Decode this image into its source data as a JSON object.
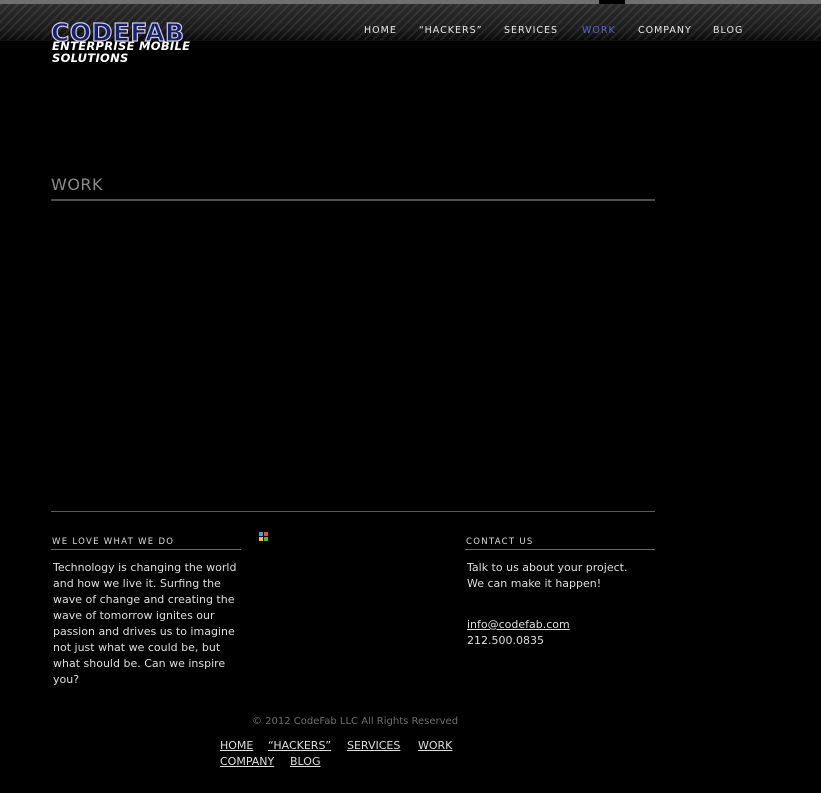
{
  "logo": {
    "brand": "CODEFAB",
    "tagline_line1": "ENTERPRISE MOBILE",
    "tagline_line2": "SOLUTIONS"
  },
  "nav": {
    "items": [
      {
        "label": "HOME",
        "active": false
      },
      {
        "label": "“HACKERS”",
        "active": false
      },
      {
        "label": "SERVICES",
        "active": false
      },
      {
        "label": "WORK",
        "active": true
      },
      {
        "label": "COMPANY",
        "active": false
      },
      {
        "label": "BLOG",
        "active": false
      }
    ]
  },
  "page": {
    "title": "WORK"
  },
  "footer": {
    "about": {
      "heading": "WE LOVE WHAT WE DO",
      "text": "Technology is changing the world and how we live it. Surfing the wave of change and creating the wave of tomorrow ignites our passion and drives us to imagine not just what we could be, but what should be. Can we inspire you?"
    },
    "contact": {
      "heading": "CONTACT US",
      "text": "Talk to us about your project. We can make it happen!",
      "email": "info@codefab.com",
      "phone": "212.500.0835"
    },
    "copyright": "© 2012 CodeFab LLC All Rights Reserved",
    "links": [
      "HOME",
      "“HACKERS”",
      "SERVICES",
      "WORK",
      "COMPANY",
      "BLOG"
    ]
  },
  "colors": {
    "background": "#000000",
    "active_nav": "#5f5fd6",
    "logo_blue": "#1a1f6a"
  }
}
